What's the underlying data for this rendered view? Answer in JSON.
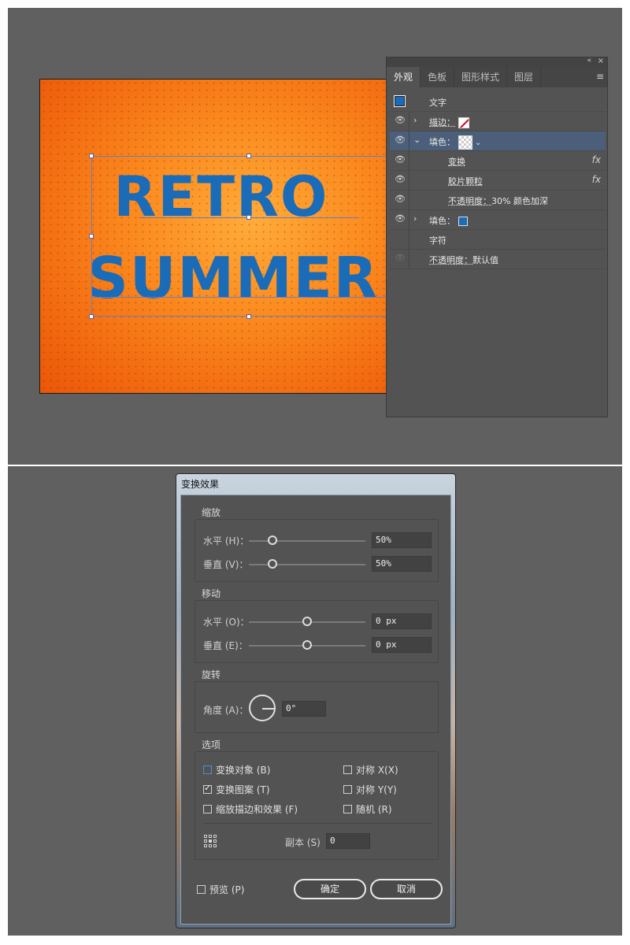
{
  "artboard": {
    "line1": "RETRO",
    "line2": "SUMMER"
  },
  "appearance_panel": {
    "collapse_icon": "«",
    "close_icon": "×",
    "tabs": [
      {
        "label": "外观",
        "active": true
      },
      {
        "label": "色板",
        "active": false
      },
      {
        "label": "图形样式",
        "active": false
      },
      {
        "label": "图层",
        "active": false
      }
    ],
    "menu_icon": "≡",
    "rows": {
      "title": "文字",
      "stroke_label": "描边：",
      "fill_label": "填色：",
      "transform_label": "变换",
      "grain_label": "胶片颗粒",
      "opacity_label": "不透明度：",
      "opacity_value": "30% 颜色加深",
      "fill2_label": "填色：",
      "chars_label": "字符",
      "opacity2_label": "不透明度：",
      "opacity2_value": "默认值",
      "fx": "fx"
    },
    "colors": {
      "fill_blue": "#1a6bb8",
      "selected_row": "#4c5f7a"
    }
  },
  "transform_dialog": {
    "title": "变换效果",
    "scale": {
      "title": "缩放",
      "horizontal_label": "水平 (H)：",
      "horizontal_value": "50%",
      "horizontal_level": 0.2,
      "vertical_label": "垂直 (V)：",
      "vertical_value": "50%",
      "vertical_level": 0.2
    },
    "move": {
      "title": "移动",
      "horizontal_label": "水平 (O)：",
      "horizontal_value": "0 px",
      "vertical_label": "垂直 (E)：",
      "vertical_value": "0 px"
    },
    "rotate": {
      "title": "旋转",
      "angle_label": "角度 (A)：",
      "angle_value": "0°"
    },
    "options": {
      "title": "选项",
      "transform_objects": "变换对象 (B)",
      "transform_patterns": "变换图案 (T)",
      "scale_strokes": "缩放描边和效果 (F)",
      "reflect_x": "对称 X(X)",
      "reflect_y": "对称 Y(Y)",
      "random": "随机 (R)",
      "copies_label": "副本 (S)",
      "copies_value": "0"
    },
    "preview_label": "预览 (P)",
    "ok_label": "确定",
    "cancel_label": "取消"
  }
}
